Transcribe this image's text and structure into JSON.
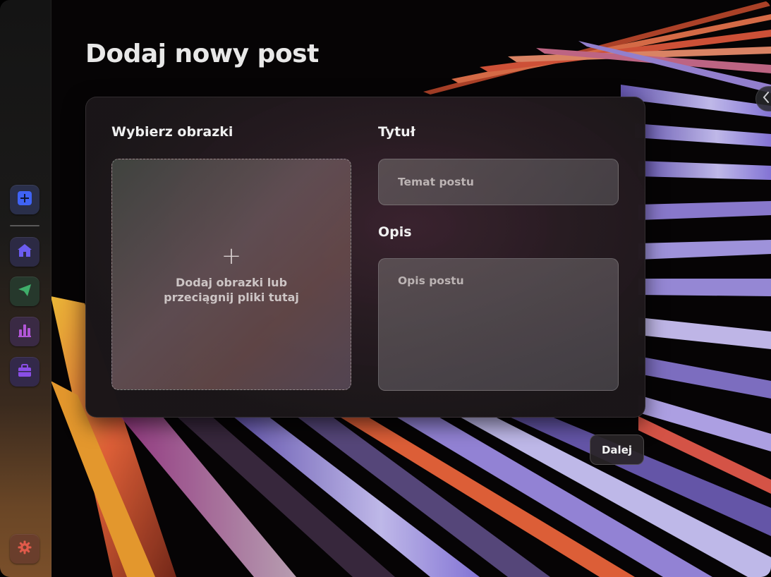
{
  "page": {
    "title": "Dodaj nowy post"
  },
  "sidebar": {
    "items": [
      {
        "name": "add-post",
        "icon": "plus-square-icon",
        "bg": "#2a2f4a",
        "fg": "#3f63f5"
      },
      {
        "name": "home",
        "icon": "home-icon",
        "bg": "#2c2a44",
        "fg": "#6b5cf0"
      },
      {
        "name": "send",
        "icon": "paper-plane-icon",
        "bg": "#26382c",
        "fg": "#3fae6a"
      },
      {
        "name": "stats",
        "icon": "bar-chart-icon",
        "bg": "#3a2a44",
        "fg": "#b156d6"
      },
      {
        "name": "briefcase",
        "icon": "briefcase-icon",
        "bg": "#33294a",
        "fg": "#8a4ee6"
      }
    ],
    "settings": {
      "icon": "gear-icon",
      "bg": "#6a3e2c",
      "fg": "#e05a4a"
    }
  },
  "form": {
    "images_label": "Wybierz obrazki",
    "dropzone_plus": "+",
    "dropzone_text": "Dodaj obrazki lub przeciągnij pliki tutaj",
    "title_label": "Tytuł",
    "title_placeholder": "Temat postu",
    "title_value": "",
    "description_label": "Opis",
    "description_placeholder": "Opis postu",
    "description_value": ""
  },
  "actions": {
    "next_label": "Dalej"
  },
  "colors": {
    "accent_blue": "#3f63f5",
    "stripe_orange": "#e8643a",
    "stripe_lilac": "#b9b0f0",
    "stripe_yellow": "#f2b636"
  }
}
